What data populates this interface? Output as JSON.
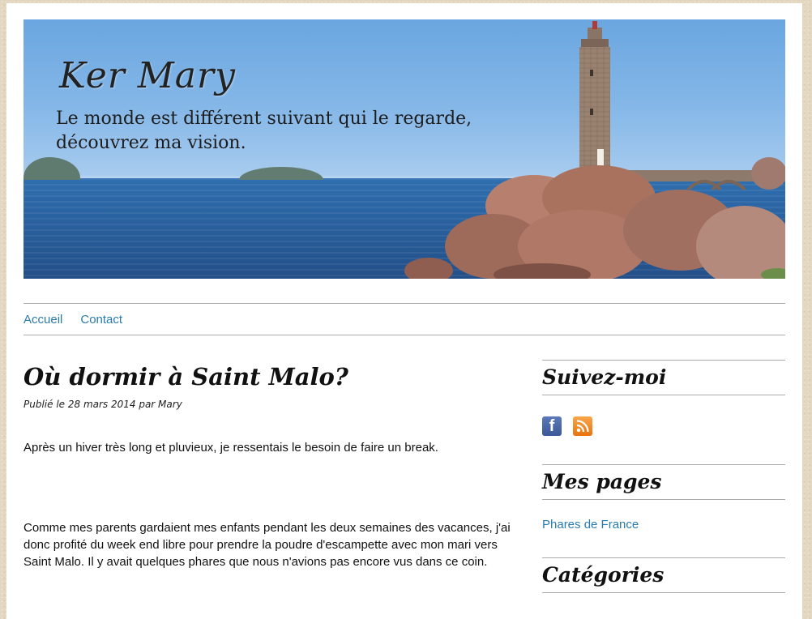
{
  "header": {
    "site_title": "Ker Mary",
    "site_description_line1": "Le monde est différent suivant qui le regarde,",
    "site_description_line2": "découvrez ma vision."
  },
  "nav": {
    "items": [
      {
        "label": "Accueil"
      },
      {
        "label": "Contact"
      }
    ]
  },
  "post": {
    "title": "Où dormir à Saint Malo?",
    "meta": "Publié le 28 mars 2014 par Mary",
    "paragraphs": [
      "Après un hiver très long et pluvieux, je ressentais le besoin de faire un break.",
      "Comme mes parents gardaient mes enfants pendant les deux semaines des vacances, j'ai donc profité du week end libre pour prendre la poudre d'escampette avec mon mari vers Saint Malo. Il y avait quelques phares que nous n'avions pas encore vus dans ce coin."
    ]
  },
  "sidebar": {
    "follow_title": "Suivez-moi",
    "social_icons": [
      "facebook-icon",
      "rss-icon"
    ],
    "pages_title": "Mes pages",
    "pages_links": [
      {
        "label": "Phares de France"
      }
    ],
    "categories_title": "Catégories"
  },
  "colors": {
    "link": "#2a7bb0",
    "background": "#e3d7c0",
    "facebook": "#3b5998",
    "rss": "#e8730e"
  }
}
